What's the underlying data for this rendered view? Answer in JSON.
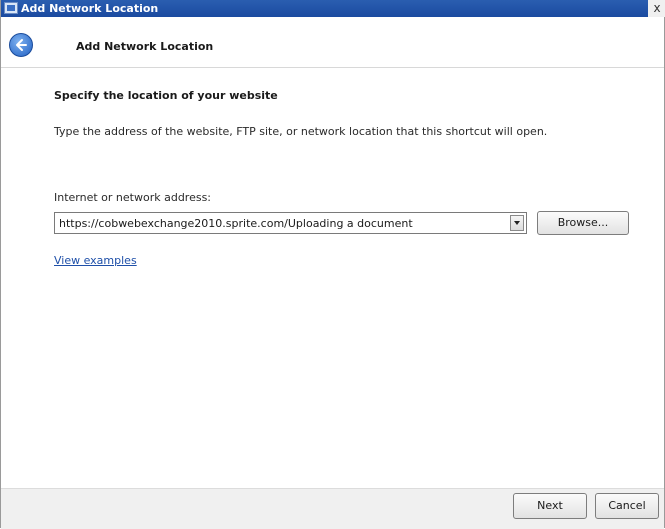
{
  "window": {
    "title": "Add Network Location",
    "close_glyph": "x"
  },
  "header": {
    "title": "Add Network Location"
  },
  "main": {
    "heading": "Specify the location of your website",
    "description": "Type the address of the website, FTP site, or network location that this shortcut will open.",
    "address_label": "Internet or network address:",
    "address_value": "https://cobwebexchange2010.sprite.com/Uploading a document",
    "browse_label": "Browse...",
    "view_examples_link": "View examples"
  },
  "footer": {
    "next_label": "Next",
    "cancel_label": "Cancel"
  },
  "icons": {
    "back": "back-arrow-icon",
    "app": "network-location-icon",
    "dropdown": "chevron-down-icon"
  },
  "colors": {
    "titlebar": "#1b4aa0",
    "link": "#1e4fa8"
  }
}
